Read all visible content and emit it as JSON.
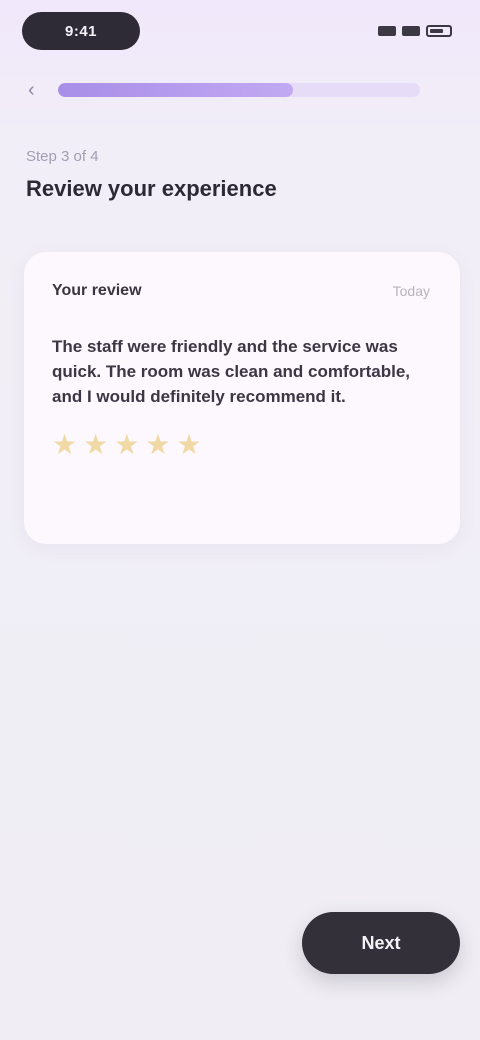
{
  "status_bar": {
    "time": "9:41",
    "icons": [
      "cellular-icon",
      "wifi-icon",
      "battery-icon"
    ]
  },
  "progress": {
    "value": 0.65
  },
  "header": {
    "step_caption": "Step 3 of 4",
    "title": "Review your experience"
  },
  "review": {
    "reviewer_name": "Your review",
    "date": "Today",
    "text": "The staff were friendly and the service was quick. The room was clean and comfortable, and I would definitely recommend it.",
    "rating": 5,
    "stars": [
      "★",
      "★",
      "★",
      "★",
      "★"
    ]
  },
  "actions": {
    "next_label": "Next"
  },
  "colors": {
    "accent": "#a98ee8",
    "star": "#f1d9a6",
    "button": "#34303a"
  }
}
